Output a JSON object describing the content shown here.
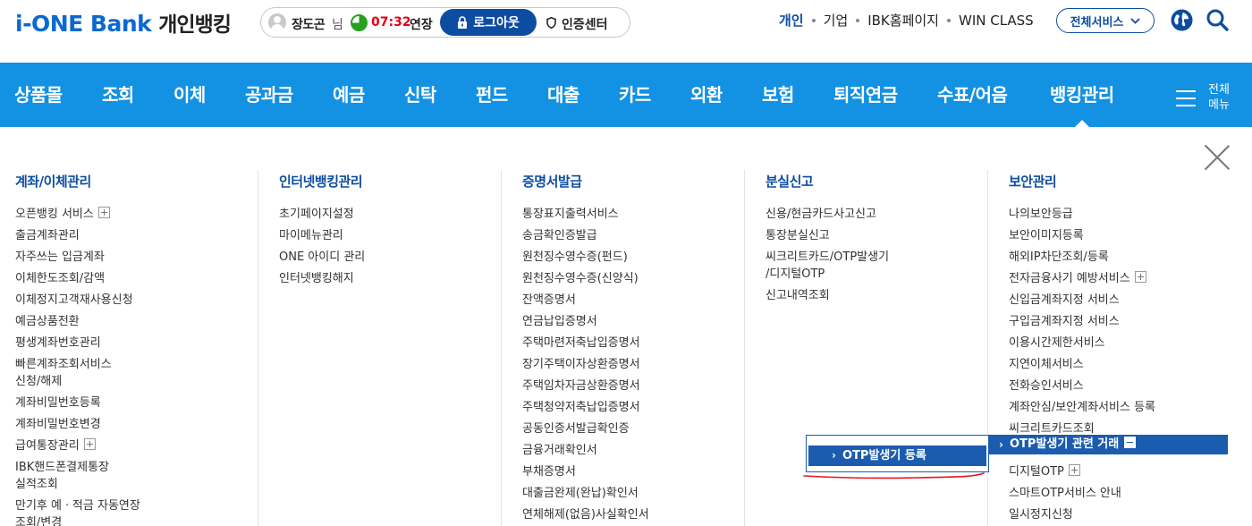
{
  "header": {
    "logo_brand": "i-ONE Bank",
    "logo_sub": "개인뱅킹",
    "session": {
      "user_name": "장도곤",
      "honorific": "님",
      "timer": "07:32",
      "extend_label": "연장",
      "logout_label": "로그아웃",
      "cert_center_label": "인증센터"
    },
    "util_links": [
      "개인",
      "기업",
      "IBK홈페이지",
      "WIN CLASS"
    ],
    "all_services_label": "전체서비스"
  },
  "nav": {
    "items": [
      "상품몰",
      "조회",
      "이체",
      "공과금",
      "예금",
      "신탁",
      "펀드",
      "대출",
      "카드",
      "외환",
      "보험",
      "퇴직연금",
      "수표/어음",
      "뱅킹관리"
    ],
    "active_item": "뱅킹관리",
    "all_menu_label_line1": "전체",
    "all_menu_label_line2": "메뉴"
  },
  "mega_menu": {
    "columns": [
      {
        "title": "계좌/이체관리",
        "items": [
          "오픈뱅킹 서비스",
          "출금계좌관리",
          "자주쓰는 입금계좌",
          "이체한도조회/감액",
          "이체정지고객재사용신청",
          "예금상품전환",
          "평생계좌번호관리",
          "빠른계좌조회서비스",
          "신청/해제",
          "계좌비밀번호등록",
          "계좌비밀번호변경",
          "급여통장관리",
          "IBK핸드폰결제통장",
          "실적조회",
          "만기후 예ㆍ적금 자동연장",
          "조회/변경"
        ]
      },
      {
        "title": "인터넷뱅킹관리",
        "items": [
          "초기페이지설정",
          "마이메뉴관리",
          "ONE 아이디 관리",
          "인터넷뱅킹해지"
        ]
      },
      {
        "title": "증명서발급",
        "items": [
          "통장표지출력서비스",
          "송금확인증발급",
          "원천징수영수증(펀드)",
          "원천징수영수증(신양식)",
          "잔액증명서",
          "연금납입증명서",
          "주택마련저축납입증명서",
          "장기주택이자상환증명서",
          "주택임차자금상환증명서",
          "주택청약저축납입증명서",
          "공동인증서발급확인증",
          "금융거래확인서",
          "부채증명서",
          "대출금완제(완납)확인서",
          "연체해제(없음)사실확인서"
        ]
      },
      {
        "title": "분실신고",
        "items": [
          "신용/현금카드사고신고",
          "통장분실신고",
          "씨크리트카드/OTP발생기",
          "/디지털OTP",
          "신고내역조회"
        ]
      },
      {
        "title": "보안관리",
        "items": [
          "나의보안등급",
          "보안이미지등록",
          "해외IP차단조회/등록",
          "전자금융사기 예방서비스",
          "신입금계좌지정 서비스",
          "구입금계좌지정 서비스",
          "이용시간제한서비스",
          "지연이체서비스",
          "전화승인서비스",
          "계좌안심/보안계좌서비스 등록",
          "씨크리트카드조회",
          "OTP발생기 관련 거래",
          "디지털OTP",
          "스마트OTP서비스 안내",
          "일시정지신청"
        ]
      }
    ],
    "expanded_item": "OTP발생기 관련 거래",
    "submenu_item": "OTP발생기 등록"
  },
  "colors": {
    "nav_bg": "#1391e3",
    "brand_blue": "#0d4da1",
    "highlight": "#1c5cae",
    "timer_red": "#e60012",
    "annotation_red": "#e8141c"
  }
}
